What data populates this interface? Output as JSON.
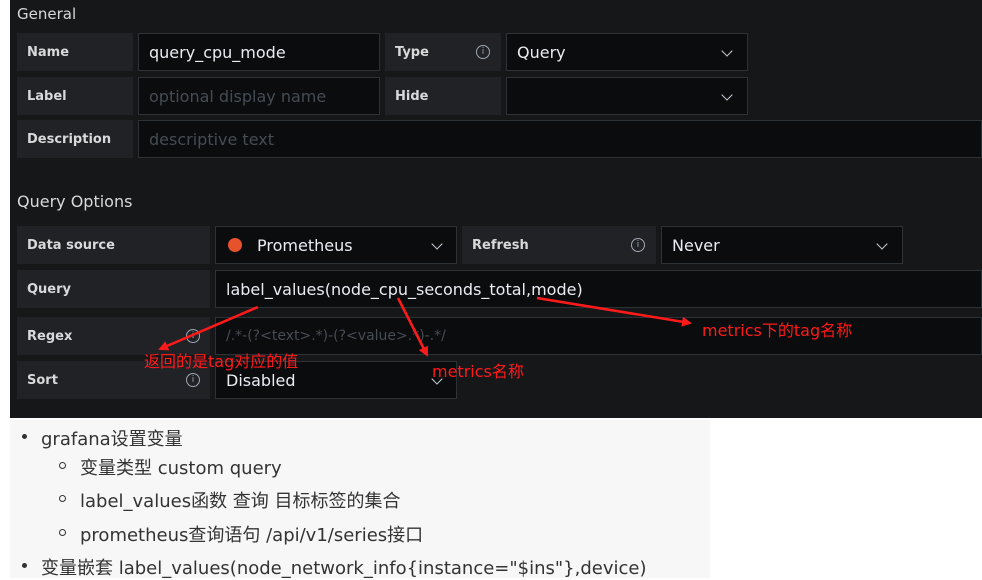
{
  "general": {
    "section_title": "General",
    "name_label": "Name",
    "name_value": "query_cpu_mode",
    "type_label": "Type",
    "type_value": "Query",
    "label_label": "Label",
    "label_placeholder": "optional display name",
    "hide_label": "Hide",
    "hide_value": "",
    "description_label": "Description",
    "description_placeholder": "descriptive text"
  },
  "query_options": {
    "section_title": "Query Options",
    "data_source_label": "Data source",
    "data_source_value": "Prometheus",
    "refresh_label": "Refresh",
    "refresh_value": "Never",
    "query_label": "Query",
    "query_value": "label_values(node_cpu_seconds_total,mode)",
    "regex_label": "Regex",
    "regex_placeholder": "/.*-(?<text>.*)-(?<value>.*)-.*/",
    "sort_label": "Sort",
    "sort_value": "Disabled"
  },
  "annotations": {
    "return_value": "返回的是tag对应的值",
    "metrics_name": "metrics名称",
    "metrics_tag": "metrics下的tag名称",
    "color": "#ff1a1a"
  },
  "notes": {
    "item1": "grafana设置变量",
    "item1_sub1": "变量类型 custom  query",
    "item1_sub2": "label_values函数 查询 目标标签的集合",
    "item1_sub3": "prometheus查询语句 /api/v1/series接口",
    "item2": "变量嵌套   label_values(node_network_info{instance=\"$ins\"},device)"
  },
  "colors": {
    "panel_bg": "#161719",
    "label_bg": "#202226",
    "input_bg": "#0b0c0e",
    "prometheus_orange": "#e6522c"
  }
}
